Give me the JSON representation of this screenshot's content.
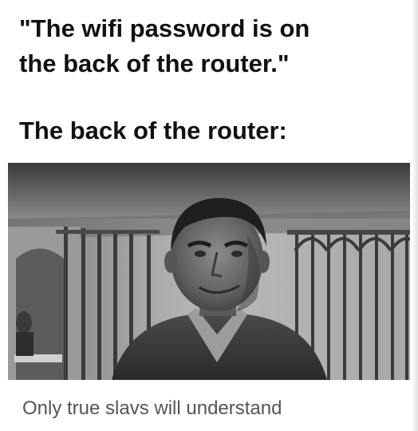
{
  "meme": {
    "top_text": "\"The wifi password is on\nthe back of the router.\"",
    "middle_text": "The back of the router:",
    "bottom_text": "Only true slavs will understand"
  },
  "photo": {
    "image_name": "man-behind-prison-bars-photo"
  }
}
